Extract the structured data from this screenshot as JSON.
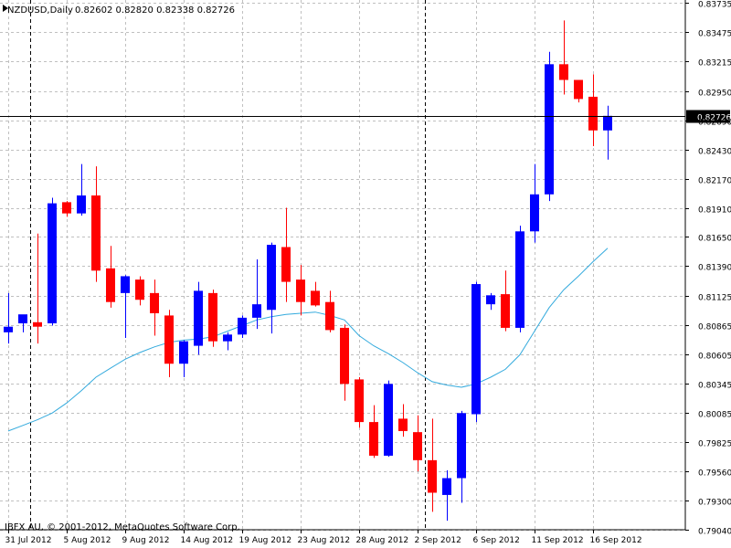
{
  "header": {
    "symbol": "NZDUSD,Daily",
    "ohlc": "0.82602 0.82820 0.82338 0.82726"
  },
  "copyright": "IBFX AU, © 2001-2012, MetaQuotes Software Corp.",
  "colors": {
    "bull": "#0000ff",
    "bear": "#ff0000",
    "ma": "#33aadd",
    "grid": "#c0c0c0",
    "price_line": "#000000"
  },
  "chart_data": {
    "type": "candlestick",
    "symbol": "NZDUSD",
    "timeframe": "Daily",
    "current_price": "0.82726",
    "ylim": [
      0.7904,
      0.8373
    ],
    "y_ticks": [
      "0.83735",
      "0.83475",
      "0.83215",
      "0.82950",
      "0.82690",
      "0.82430",
      "0.82170",
      "0.81910",
      "0.81650",
      "0.81390",
      "0.81125",
      "0.80865",
      "0.80605",
      "0.80345",
      "0.80085",
      "0.79825",
      "0.79560",
      "0.79300",
      "0.79040"
    ],
    "x_labels": [
      {
        "index": 0,
        "label": "31 Jul 2012"
      },
      {
        "index": 4,
        "label": "5 Aug 2012"
      },
      {
        "index": 8,
        "label": "9 Aug 2012"
      },
      {
        "index": 12,
        "label": "14 Aug 2012"
      },
      {
        "index": 16,
        "label": "19 Aug 2012"
      },
      {
        "index": 20,
        "label": "23 Aug 2012"
      },
      {
        "index": 24,
        "label": "28 Aug 2012"
      },
      {
        "index": 28,
        "label": "2 Sep 2012"
      },
      {
        "index": 32,
        "label": "6 Sep 2012"
      },
      {
        "index": 36,
        "label": "11 Sep 2012"
      },
      {
        "index": 40,
        "label": "16 Sep 2012"
      }
    ],
    "period_separators": [
      1,
      28
    ],
    "candles": [
      {
        "o": 0.808,
        "h": 0.8115,
        "l": 0.807,
        "c": 0.8085
      },
      {
        "o": 0.8088,
        "h": 0.8092,
        "l": 0.808,
        "c": 0.8096
      },
      {
        "o": 0.8089,
        "h": 0.8168,
        "l": 0.807,
        "c": 0.8085
      },
      {
        "o": 0.8088,
        "h": 0.82,
        "l": 0.8086,
        "c": 0.8195
      },
      {
        "o": 0.8196,
        "h": 0.8197,
        "l": 0.8183,
        "c": 0.8186
      },
      {
        "o": 0.8186,
        "h": 0.823,
        "l": 0.8184,
        "c": 0.8202
      },
      {
        "o": 0.8202,
        "h": 0.8228,
        "l": 0.8125,
        "c": 0.8135
      },
      {
        "o": 0.8137,
        "h": 0.8157,
        "l": 0.8102,
        "c": 0.8107
      },
      {
        "o": 0.8115,
        "h": 0.8131,
        "l": 0.8075,
        "c": 0.813
      },
      {
        "o": 0.8127,
        "h": 0.813,
        "l": 0.8104,
        "c": 0.8109
      },
      {
        "o": 0.8115,
        "h": 0.8127,
        "l": 0.8077,
        "c": 0.8097
      },
      {
        "o": 0.8095,
        "h": 0.81,
        "l": 0.804,
        "c": 0.8052
      },
      {
        "o": 0.8052,
        "h": 0.8073,
        "l": 0.804,
        "c": 0.8072
      },
      {
        "o": 0.8068,
        "h": 0.8125,
        "l": 0.806,
        "c": 0.8117
      },
      {
        "o": 0.8115,
        "h": 0.8118,
        "l": 0.8067,
        "c": 0.8072
      },
      {
        "o": 0.8072,
        "h": 0.808,
        "l": 0.8064,
        "c": 0.8078
      },
      {
        "o": 0.8078,
        "h": 0.8095,
        "l": 0.8075,
        "c": 0.8093
      },
      {
        "o": 0.8093,
        "h": 0.8145,
        "l": 0.8083,
        "c": 0.8105
      },
      {
        "o": 0.81,
        "h": 0.816,
        "l": 0.8079,
        "c": 0.8158
      },
      {
        "o": 0.8156,
        "h": 0.8191,
        "l": 0.8107,
        "c": 0.8125
      },
      {
        "o": 0.8127,
        "h": 0.814,
        "l": 0.8095,
        "c": 0.8107
      },
      {
        "o": 0.8117,
        "h": 0.8125,
        "l": 0.8103,
        "c": 0.8104
      },
      {
        "o": 0.8107,
        "h": 0.8117,
        "l": 0.808,
        "c": 0.8082
      },
      {
        "o": 0.8084,
        "h": 0.8087,
        "l": 0.8019,
        "c": 0.8034
      },
      {
        "o": 0.8038,
        "h": 0.804,
        "l": 0.7995,
        "c": 0.8
      },
      {
        "o": 0.8,
        "h": 0.8015,
        "l": 0.7968,
        "c": 0.797
      },
      {
        "o": 0.797,
        "h": 0.8037,
        "l": 0.7969,
        "c": 0.8034
      },
      {
        "o": 0.8003,
        "h": 0.8016,
        "l": 0.7987,
        "c": 0.7992
      },
      {
        "o": 0.7991,
        "h": 0.8006,
        "l": 0.7956,
        "c": 0.7966
      },
      {
        "o": 0.7966,
        "h": 0.8003,
        "l": 0.792,
        "c": 0.7937
      },
      {
        "o": 0.7935,
        "h": 0.7957,
        "l": 0.7912,
        "c": 0.795
      },
      {
        "o": 0.795,
        "h": 0.801,
        "l": 0.7928,
        "c": 0.8008
      },
      {
        "o": 0.8007,
        "h": 0.8125,
        "l": 0.8,
        "c": 0.8123
      },
      {
        "o": 0.8105,
        "h": 0.8115,
        "l": 0.81,
        "c": 0.8113
      },
      {
        "o": 0.8114,
        "h": 0.8135,
        "l": 0.8081,
        "c": 0.8084
      },
      {
        "o": 0.8084,
        "h": 0.8175,
        "l": 0.808,
        "c": 0.817
      },
      {
        "o": 0.817,
        "h": 0.823,
        "l": 0.816,
        "c": 0.8203
      },
      {
        "o": 0.8203,
        "h": 0.833,
        "l": 0.8197,
        "c": 0.8319
      },
      {
        "o": 0.8319,
        "h": 0.8358,
        "l": 0.8292,
        "c": 0.8305
      },
      {
        "o": 0.8305,
        "h": 0.8303,
        "l": 0.8285,
        "c": 0.8288
      },
      {
        "o": 0.829,
        "h": 0.831,
        "l": 0.8246,
        "c": 0.826
      },
      {
        "o": 0.826,
        "h": 0.8282,
        "l": 0.8234,
        "c": 0.8273
      }
    ],
    "moving_average": [
      0.7992,
      0.7997,
      0.8002,
      0.8008,
      0.8017,
      0.8028,
      0.804,
      0.8048,
      0.8056,
      0.8062,
      0.8067,
      0.8071,
      0.8073,
      0.8074,
      0.8076,
      0.8081,
      0.8086,
      0.8091,
      0.8094,
      0.8096,
      0.8097,
      0.8098,
      0.8095,
      0.8091,
      0.8077,
      0.8068,
      0.8061,
      0.8053,
      0.8044,
      0.8036,
      0.8033,
      0.8031,
      0.8034,
      0.804,
      0.8047,
      0.806,
      0.8081,
      0.8102,
      0.8118,
      0.813,
      0.8143,
      0.8155
    ]
  }
}
